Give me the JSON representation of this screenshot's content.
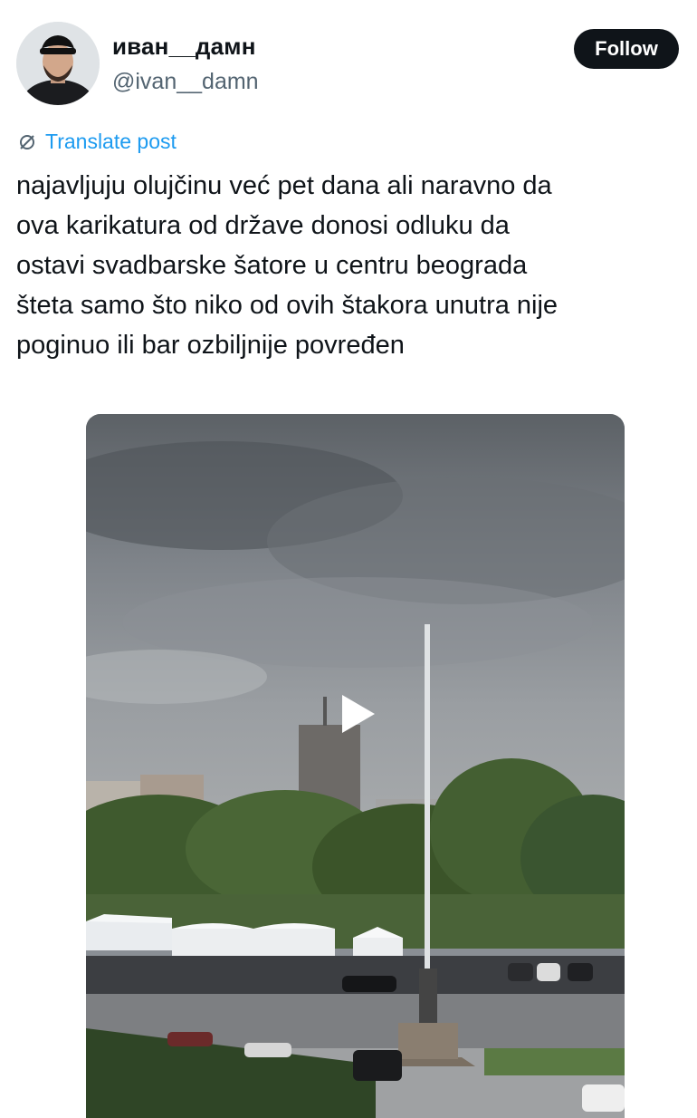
{
  "user": {
    "display_name": "иван__дамн",
    "handle": "@ivan__damn"
  },
  "follow_button": {
    "label": "Follow"
  },
  "translate": {
    "label": "Translate post",
    "icon": "globe-slash-icon",
    "color": "#1d9bf0"
  },
  "post": {
    "text": "najavljuju olujčinu već pet dana ali naravno da\nova karikatura od države donosi odluku da\nostavi svadbarske šatore u centru beograda\nšteta samo što niko od ovih štakora unutra nije\npoginuo ili bar ozbiljnije povređen"
  },
  "media": {
    "type": "video",
    "play_icon": "play-icon"
  },
  "colors": {
    "text": "#0f1419",
    "muted": "#536471",
    "accent": "#1d9bf0",
    "button_bg": "#0f1419"
  }
}
